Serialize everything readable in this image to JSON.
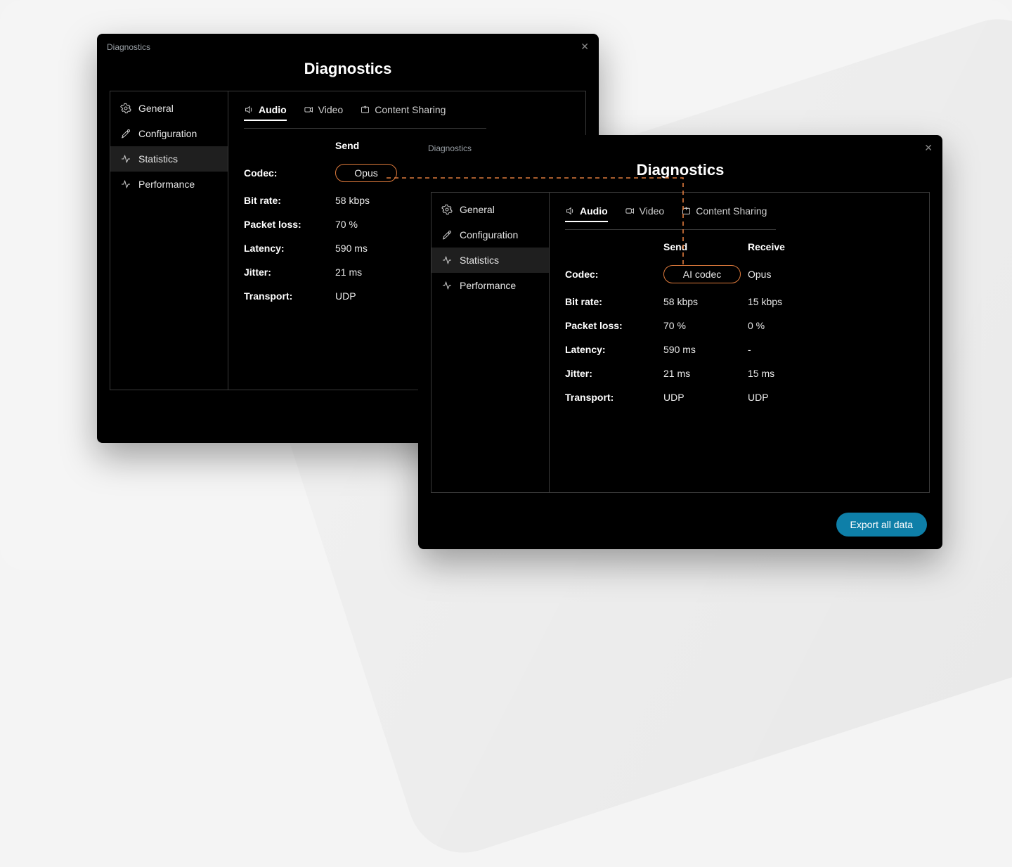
{
  "sidebar": [
    "General",
    "Configuration",
    "Statistics",
    "Performance"
  ],
  "tabs": [
    "Audio",
    "Video",
    "Content Sharing"
  ],
  "cols": {
    "send": "Send",
    "receive": "Receive"
  },
  "rows": {
    "codec": "Codec:",
    "bitrate": "Bit rate:",
    "packetloss": "Packet loss:",
    "latency": "Latency:",
    "jitter": "Jitter:",
    "transport": "Transport:"
  },
  "win1": {
    "title": "Diagnostics",
    "heading": "Diagnostics",
    "stats": {
      "codec": {
        "send": "Opus"
      },
      "bitrate": {
        "send": "58 kbps"
      },
      "packetloss": {
        "send": "70 %"
      },
      "latency": {
        "send": "590 ms"
      },
      "jitter": {
        "send": "21 ms"
      },
      "transport": {
        "send": "UDP"
      }
    }
  },
  "win2": {
    "title": "Diagnostics",
    "heading": "Diagnostics",
    "stats": {
      "codec": {
        "send": "AI codec",
        "receive": "Opus"
      },
      "bitrate": {
        "send": "58 kbps",
        "receive": "15 kbps"
      },
      "packetloss": {
        "send": "70 %",
        "receive": "0 %"
      },
      "latency": {
        "send": "590 ms",
        "receive": "-"
      },
      "jitter": {
        "send": "21 ms",
        "receive": "15 ms"
      },
      "transport": {
        "send": "UDP",
        "receive": "UDP"
      }
    }
  },
  "export_label": "Export all data",
  "accent": "#e07b3c"
}
